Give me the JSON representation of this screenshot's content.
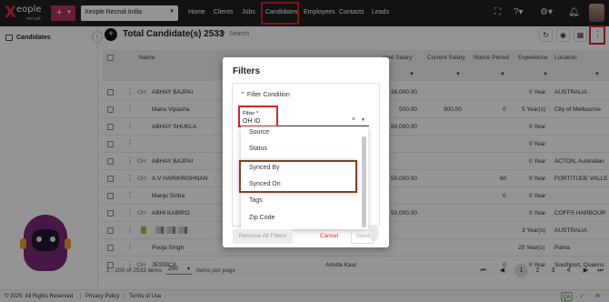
{
  "brand": {
    "mark": "X",
    "name": "eople",
    "sub": "recruit"
  },
  "header": {
    "org_select": "Xeople Recruit India",
    "nav": [
      "Home",
      "Clients",
      "Jobs",
      "Candidates",
      "Employees",
      "Contacts",
      "Leads"
    ],
    "active_nav": "Candidates",
    "icons": [
      "fullscreen-icon",
      "help-icon",
      "settings-icon",
      "bell-icon",
      "avatar"
    ]
  },
  "sidebar": {
    "title": "Candidates"
  },
  "toolbar": {
    "title": "Total Candidate(s) 2533",
    "search_placeholder": "Search"
  },
  "table": {
    "columns": [
      "Name",
      "cted Salary",
      "Current Salary",
      "Notice Period",
      "Experience",
      "Location"
    ],
    "rows": [
      {
        "tag": "OH",
        "name": "ABHAY BAJPAI",
        "exp_salary": "35,000.00",
        "cur_salary": "",
        "notice": "",
        "experience": "0 Year",
        "location": "AUSTRALIA"
      },
      {
        "tag": "",
        "name": "Manu Vipasha",
        "exp_salary": "500.00",
        "cur_salary": "300.00",
        "notice": "0",
        "experience": "5 Year(s)",
        "location": "City of Melbourne"
      },
      {
        "tag": "",
        "name": "ABHAY SHUKLA",
        "exp_salary": "80,000.00",
        "cur_salary": "",
        "notice": "",
        "experience": "0 Year",
        "location": ""
      },
      {
        "tag": "",
        "name": "",
        "exp_salary": "",
        "cur_salary": "",
        "notice": "",
        "experience": "0 Year",
        "location": ""
      },
      {
        "tag": "OH",
        "name": "ABHAY BAJPAI",
        "exp_salary": "",
        "cur_salary": "",
        "notice": "",
        "experience": "0 Year",
        "location": "ACTON, Australian"
      },
      {
        "tag": "OH",
        "name": "A.V HARIKRISHNAN",
        "exp_salary": "50,000.00",
        "cur_salary": "",
        "notice": "60",
        "experience": "0 Year",
        "location": "FORTITUDE VALLE"
      },
      {
        "tag": "",
        "name": "Manju Sinha",
        "exp_salary": "",
        "cur_salary": "",
        "notice": "0",
        "experience": "0 Year",
        "location": ""
      },
      {
        "tag": "OH",
        "name": "ABHI KABIRO",
        "exp_salary": "50,000.00",
        "cur_salary": "",
        "notice": "",
        "experience": "0 Year",
        "location": "COFFS HARBOUR"
      },
      {
        "tag": "",
        "name": "",
        "exp_salary": "",
        "cur_salary": "",
        "notice": "",
        "experience": "3 Year(s)",
        "location": "AUSTRALIA"
      },
      {
        "tag": "",
        "name": "Pooja Singh",
        "exp_salary": "",
        "cur_salary": "",
        "notice": "",
        "experience": "25 Year(s)",
        "location": "Patna"
      },
      {
        "tag": "OH",
        "name": "JESSICA",
        "exp_salary": "Amrita Kaur",
        "cur_salary": "",
        "notice": "0",
        "experience": "0 Year",
        "location": "Southport, Queens"
      }
    ]
  },
  "pagination": {
    "range": "1 - 200 of 2533 items",
    "page_size": "200",
    "per_page_label": "items per page",
    "pages": [
      "1",
      "2",
      "3",
      "4"
    ],
    "current": "1"
  },
  "footer": {
    "copyright": "© 2025. All Rights Reserved",
    "privacy": "Privacy Policy",
    "terms": "Terms of Use",
    "badge": "QA"
  },
  "modal": {
    "title": "Filters",
    "section": "Filter Condition",
    "filter_label": "Filter",
    "filter_required": "*",
    "filter_value": "OH ID",
    "options": [
      "Source",
      "Status",
      "Synced By",
      "Synced On",
      "Tags",
      "Zip Code"
    ],
    "buttons": {
      "remove_all": "Remove All Filters",
      "cancel": "Cancel",
      "save": "Save"
    }
  },
  "colors": {
    "topbar": "#1f1f1f",
    "accent": "#b5336b",
    "highlight_red": "#d8232a",
    "synced_box": "#7a4520"
  }
}
